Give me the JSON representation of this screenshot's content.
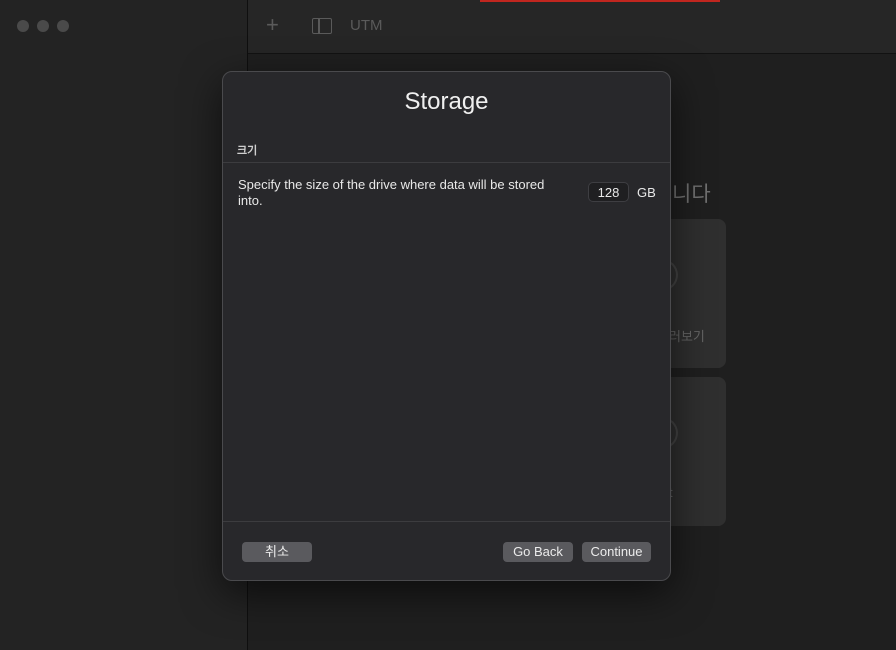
{
  "app": {
    "title": "UTM",
    "toolbar_plus": "+"
  },
  "background": {
    "heading_fragment": "니다",
    "card1_label": "러보기",
    "card2_label": "t"
  },
  "dialog": {
    "title": "Storage",
    "section_label": "크기",
    "description": "Specify the size of the drive where data will be stored into.",
    "size_value": "128",
    "size_unit": "GB",
    "cancel_label": "취소",
    "back_label": "Go Back",
    "continue_label": "Continue"
  }
}
